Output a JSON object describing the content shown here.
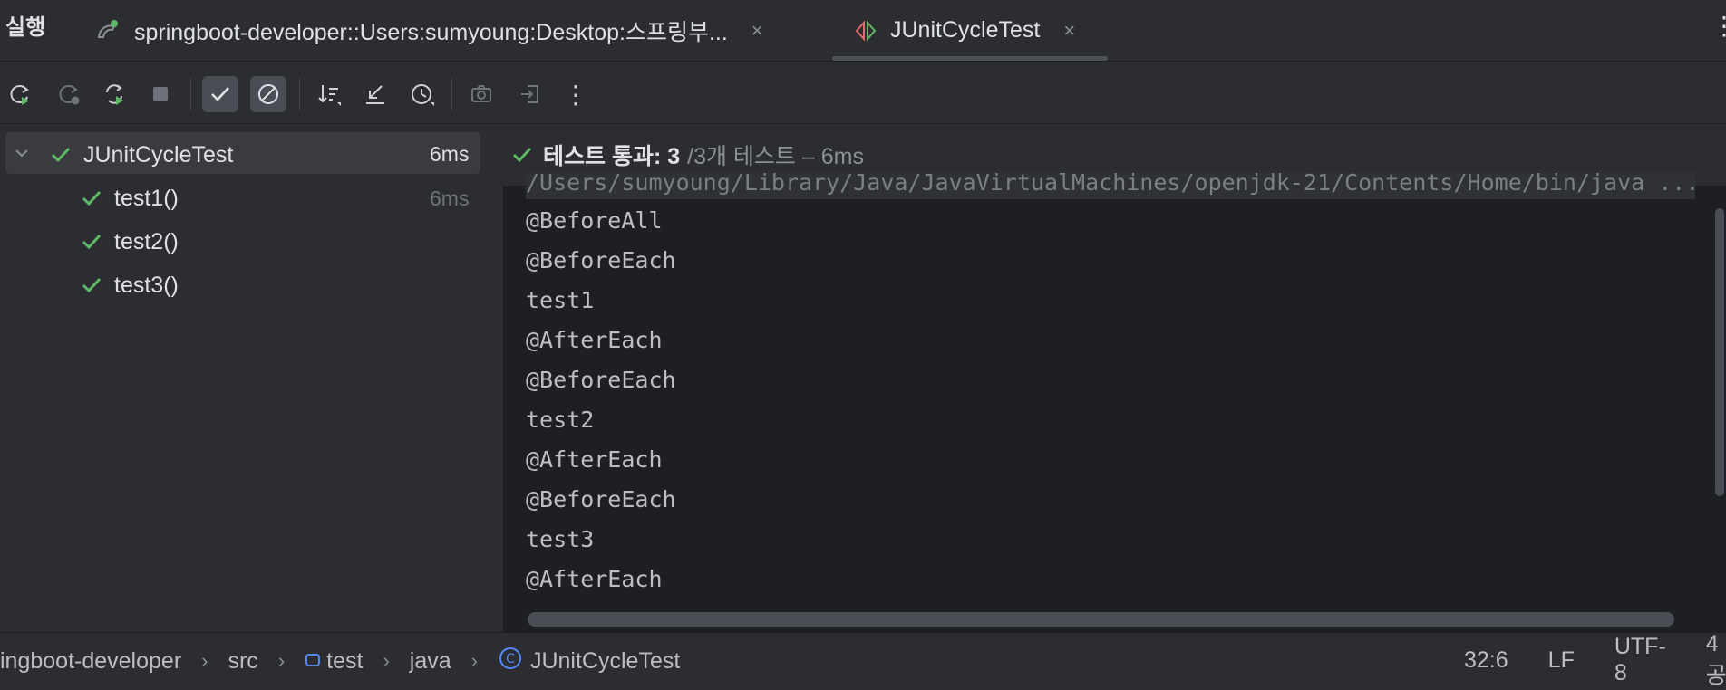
{
  "tabbar": {
    "run_title": "실행",
    "tabs": [
      {
        "label": "springboot-developer::Users:sumyoung:Desktop:스프링부...",
        "close": "×"
      },
      {
        "label": "JUnitCycleTest",
        "close": "×"
      }
    ],
    "more": "⋮"
  },
  "toolbar": {
    "buttons": [
      "rerun-icon",
      "rerun-failed-icon",
      "toggle-auto-test-icon",
      "stop-icon",
      "show-passed-icon",
      "show-ignored-icon",
      "sort-icon",
      "collapse-icon",
      "history-icon",
      "screenshot-icon",
      "export-icon",
      "more-icon"
    ],
    "more_label": "⋮"
  },
  "tree": {
    "root": {
      "label": "JUnitCycleTest",
      "time": "6ms"
    },
    "children": [
      {
        "label": "test1()",
        "time": "6ms"
      },
      {
        "label": "test2()",
        "time": ""
      },
      {
        "label": "test3()",
        "time": ""
      }
    ]
  },
  "console": {
    "status_main": "테스트 통과: 3",
    "status_rest": "/3개 테스트 – 6ms",
    "cut_line": "/Users/sumyoung/Library/Java/JavaVirtualMachines/openjdk-21/Contents/Home/bin/java ...",
    "lines": [
      "@BeforeAll",
      "@BeforeEach",
      "test1",
      "@AfterEach",
      "@BeforeEach",
      "test2",
      "@AfterEach",
      "@BeforeEach",
      "test3",
      "@AfterEach"
    ]
  },
  "statusbar": {
    "breadcrumb": [
      "ingboot-developer",
      "src",
      "test",
      "java",
      "JUnitCycleTest"
    ],
    "separator": "›",
    "position": "32:6",
    "line_ending": "LF",
    "encoding": "UTF-8",
    "indent": "4공"
  },
  "colors": {
    "background": "#2b2d30",
    "console": "#1e1f22",
    "pass_green": "#5fb865",
    "text": "#dfe1e5",
    "muted": "#8c8f94"
  }
}
